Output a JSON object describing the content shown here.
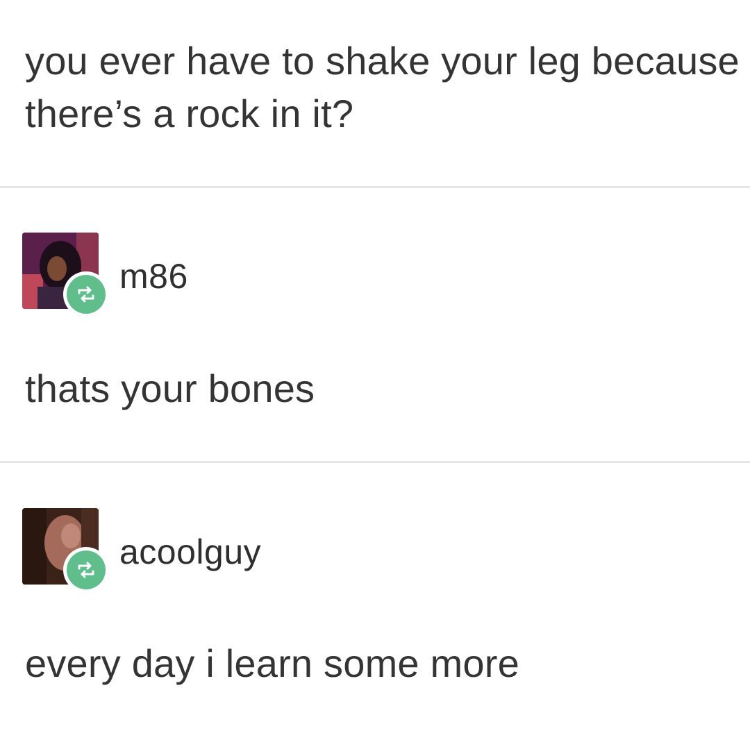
{
  "original_post": {
    "text": "you ever have to shake your leg because there’s a rock in it?"
  },
  "replies": [
    {
      "username": "m86",
      "text": "thats your bones",
      "avatar_icon": "user-avatar-photo",
      "badge_icon": "reblog-icon"
    },
    {
      "username": "acoolguy",
      "text": "every day i learn some more",
      "avatar_icon": "user-avatar-photo",
      "badge_icon": "reblog-icon"
    }
  ],
  "colors": {
    "background": "#ffffff",
    "text": "#343434",
    "divider": "#e6e6e6",
    "reblog_badge": "#5fbe8c"
  }
}
